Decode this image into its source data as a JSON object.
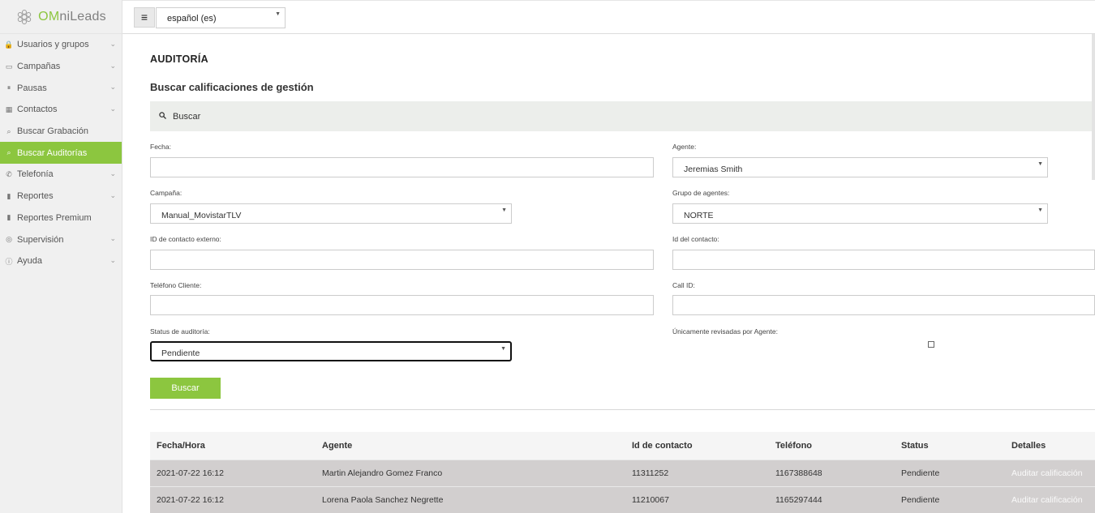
{
  "brand": {
    "name_prefix": "OM",
    "name_suffix": "niLeads"
  },
  "topbar": {
    "menu_icon": "≡",
    "language": "español (es)"
  },
  "sidebar": {
    "items": [
      {
        "label": "Usuarios y grupos",
        "icon": "lock-icon",
        "glyph": "🔒",
        "expandable": true
      },
      {
        "label": "Campañas",
        "icon": "campaign-icon",
        "glyph": "▭",
        "expandable": true
      },
      {
        "label": "Pausas",
        "icon": "pause-icon",
        "glyph": "⏸",
        "expandable": true
      },
      {
        "label": "Contactos",
        "icon": "contacts-icon",
        "glyph": "▦",
        "expandable": true
      },
      {
        "label": "Buscar Grabación",
        "icon": "search-icon",
        "glyph": "⌕",
        "expandable": false
      },
      {
        "label": "Buscar Auditorías",
        "icon": "search-icon",
        "glyph": "⌕",
        "expandable": false,
        "active": true
      },
      {
        "label": "Telefonía",
        "icon": "phone-icon",
        "glyph": "✆",
        "expandable": true
      },
      {
        "label": "Reportes",
        "icon": "bar-chart-icon",
        "glyph": "▮",
        "expandable": true
      },
      {
        "label": "Reportes Premium",
        "icon": "bar-chart-icon",
        "glyph": "▮",
        "expandable": false
      },
      {
        "label": "Supervisión",
        "icon": "headset-icon",
        "glyph": "◎",
        "expandable": true
      },
      {
        "label": "Ayuda",
        "icon": "info-icon",
        "glyph": "ⓘ",
        "expandable": true
      }
    ],
    "chevron": "⌄"
  },
  "page": {
    "title": "AUDITORÍA",
    "section_title": "Buscar calificaciones de gestión",
    "search_panel_label": "Buscar"
  },
  "form": {
    "fecha": {
      "label": "Fecha:",
      "value": ""
    },
    "agente": {
      "label": "Agente:",
      "value": "Jeremias Smith"
    },
    "campana": {
      "label": "Campaña:",
      "value": "Manual_MovistarTLV"
    },
    "grupo": {
      "label": "Grupo de agentes:",
      "value": "NORTE"
    },
    "id_externo": {
      "label": "ID de contacto externo:",
      "value": ""
    },
    "id_contacto": {
      "label": "Id del contacto:",
      "value": ""
    },
    "telefono": {
      "label": "Teléfono Cliente:",
      "value": ""
    },
    "call_id": {
      "label": "Call ID:",
      "value": ""
    },
    "status": {
      "label": "Status de auditoría:",
      "value": "Pendiente"
    },
    "revisadas": {
      "label": "Únicamente revisadas por Agente:",
      "checked": false
    },
    "submit_label": "Buscar"
  },
  "table": {
    "headers": [
      "Fecha/Hora",
      "Agente",
      "Id de contacto",
      "Teléfono",
      "Status",
      "Detalles"
    ],
    "rows": [
      [
        "2021-07-22 16:12",
        "Martin Alejandro Gomez Franco",
        "11311252",
        "1167388648",
        "Pendiente",
        "Auditar calificación"
      ],
      [
        "2021-07-22 16:12",
        "Lorena Paola Sanchez Negrette",
        "11210067",
        "1165297444",
        "Pendiente",
        "Auditar calificación"
      ]
    ]
  },
  "colors": {
    "accent": "#8cc63f",
    "row_bg": "#d2cfcf",
    "panel_bg": "#eceeeb"
  }
}
